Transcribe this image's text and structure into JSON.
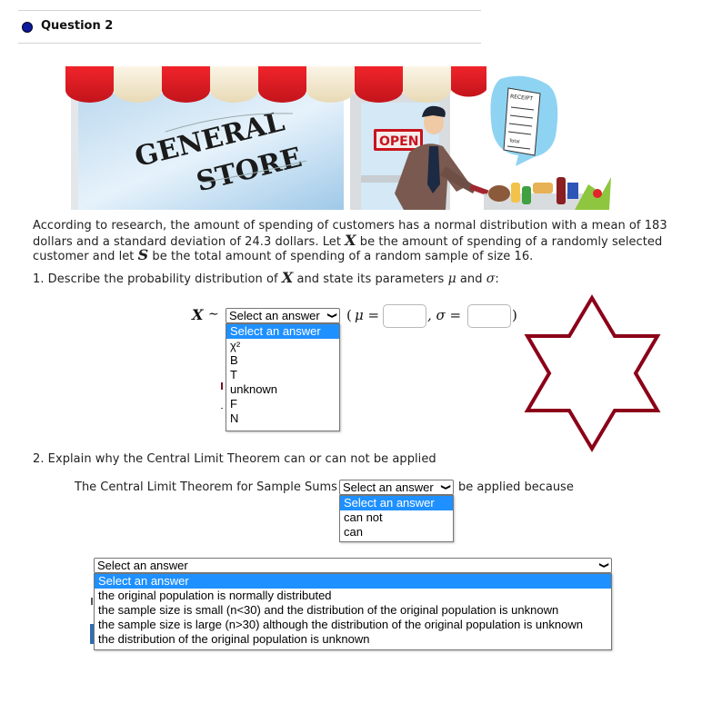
{
  "question": {
    "title": "Question 2",
    "status_color": "#0c1a9e"
  },
  "illustration": {
    "alt": "General store illustration with a man pushing a shopping cart",
    "sign_text": "GENERAL STORE",
    "open_sign": "OPEN",
    "receipt_title": "RECEIPT",
    "receipt_total": "Total"
  },
  "problem": {
    "line1": "According to research, the amount of spending of customers has a normal distribution with a mean of 183",
    "line2_a": "dollars and a standard deviation of 24.3 dollars. Let ",
    "line2_var": "X",
    "line2_b": " be the amount of spending of a randomly selected",
    "line3_a": "customer and let ",
    "line3_var": "S",
    "line3_b": "  be the total amount of spending of a random sample of size 16."
  },
  "part1": {
    "prompt_a": "1. Describe the probability distribution of ",
    "prompt_var": "X",
    "prompt_b": " and state its parameters ",
    "mu": "μ",
    "and": " and ",
    "sigma": "σ",
    "colon": ":",
    "dist_var": "X",
    "tilde": "∼",
    "open_paren": "(",
    "mu_eq": "μ =",
    "comma_sigma_eq": ", σ =",
    "close_paren": ")",
    "dist_select": {
      "value": "Select an answer",
      "options": [
        "Select an answer",
        "χ²",
        "B",
        "T",
        "unknown",
        "F",
        "N"
      ],
      "highlighted_index": 0
    },
    "mu_input": {
      "value": ""
    },
    "sigma_input": {
      "value": ""
    }
  },
  "decoration": {
    "star_icon_color": "#8b0018"
  },
  "part2": {
    "prompt": "2. Explain why the Central Limit Theorem can or can not be applied",
    "sentence_a": "The Central Limit Theorem for Sample Sums",
    "sentence_b": "be applied because",
    "can_select": {
      "value": "Select an answer",
      "options": [
        "Select an answer",
        "can not",
        "can"
      ],
      "highlighted_index": 0
    },
    "reason_select": {
      "value": "Select an answer",
      "options": [
        "Select an answer",
        "the original population is normally distributed",
        "the sample size is small (n<30) and the distribution of the original population is unknown",
        "the sample size is large (n>30) although the distribution of the original population is unknown",
        "the distribution of the original population is unknown"
      ],
      "highlighted_index": 0
    }
  },
  "colors": {
    "highlight": "#1e90ff",
    "border": "#767676"
  }
}
